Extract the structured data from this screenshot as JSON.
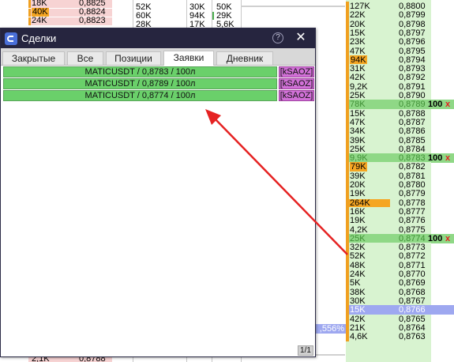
{
  "window": {
    "title": "Сделки",
    "help_icon": "help-icon",
    "close_icon": "close-icon",
    "help_glyph": "?",
    "close_glyph": "✕",
    "tabs": [
      {
        "label": "Закрытые",
        "active": false
      },
      {
        "label": "Все",
        "active": false
      },
      {
        "label": "Позиции",
        "active": false
      },
      {
        "label": "Заявки",
        "active": true
      },
      {
        "label": "Дневник",
        "active": false
      }
    ],
    "orders": [
      {
        "text": "MATICUSDT / 0,8783 / 100л",
        "tag": "[kSAOZ]"
      },
      {
        "text": "MATICUSDT / 0,8789 / 100л",
        "tag": "[kSAOZ]"
      },
      {
        "text": "MATICUSDT / 0,8774 / 100л",
        "tag": "[kSAOZ]"
      }
    ],
    "pager": "1/1"
  },
  "left_book": {
    "rows_top": [
      {
        "vol": "18K",
        "price": "0,8825"
      },
      {
        "vol": "40K",
        "price": "0,8824"
      },
      {
        "vol": "24K",
        "price": "0,8823"
      }
    ],
    "row_bottom": {
      "vol": "2,1K",
      "price": "0,8788"
    }
  },
  "middle_columns": {
    "col1": [
      "52K",
      "60K",
      "28K"
    ],
    "col2": [
      "30K",
      "94K",
      "17K"
    ],
    "col3": [
      "50K",
      "29K",
      "5,6K"
    ]
  },
  "right_book": {
    "percent_label": ",556%",
    "rows": [
      {
        "vol": "127K",
        "price": "0,8800",
        "type": "ask"
      },
      {
        "vol": "22K",
        "price": "0,8799",
        "type": "ask"
      },
      {
        "vol": "20K",
        "price": "0,8798",
        "type": "ask"
      },
      {
        "vol": "15K",
        "price": "0,8797",
        "type": "ask"
      },
      {
        "vol": "23K",
        "price": "0,8796",
        "type": "ask"
      },
      {
        "vol": "47K",
        "price": "0,8795",
        "type": "ask"
      },
      {
        "vol": "94K",
        "price": "0,8794",
        "type": "ask",
        "hl": true
      },
      {
        "vol": "31K",
        "price": "0,8793",
        "type": "ask"
      },
      {
        "vol": "42K",
        "price": "0,8792",
        "type": "ask"
      },
      {
        "vol": "9,2K",
        "price": "0,8791",
        "type": "ask"
      },
      {
        "vol": "25K",
        "price": "0,8790",
        "type": "ask"
      },
      {
        "vol": "78K",
        "price": "0,8789",
        "type": "lvl",
        "order_qty": "100",
        "order_x": "x"
      },
      {
        "vol": "15K",
        "price": "0,8788",
        "type": "ask"
      },
      {
        "vol": "47K",
        "price": "0,8787",
        "type": "ask"
      },
      {
        "vol": "34K",
        "price": "0,8786",
        "type": "ask"
      },
      {
        "vol": "39K",
        "price": "0,8785",
        "type": "ask"
      },
      {
        "vol": "25K",
        "price": "0,8784",
        "type": "ask"
      },
      {
        "vol": "9,9K",
        "price": "0,8783",
        "type": "lvl",
        "order_qty": "100",
        "order_x": "x"
      },
      {
        "vol": "79K",
        "price": "0,8782",
        "type": "ask",
        "hl": true
      },
      {
        "vol": "39K",
        "price": "0,8781",
        "type": "ask"
      },
      {
        "vol": "20K",
        "price": "0,8780",
        "type": "ask"
      },
      {
        "vol": "19K",
        "price": "0,8779",
        "type": "ask"
      },
      {
        "vol": "264K",
        "price": "0,8778",
        "type": "ask",
        "bar": 0.5
      },
      {
        "vol": "16K",
        "price": "0,8777",
        "type": "ask"
      },
      {
        "vol": "19K",
        "price": "0,8776",
        "type": "ask"
      },
      {
        "vol": "4,2K",
        "price": "0,8775",
        "type": "ask"
      },
      {
        "vol": "25K",
        "price": "0,8774",
        "type": "lvl",
        "order_qty": "100",
        "order_x": "x"
      },
      {
        "vol": "32K",
        "price": "0,8773",
        "type": "ask"
      },
      {
        "vol": "52K",
        "price": "0,8772",
        "type": "ask"
      },
      {
        "vol": "48K",
        "price": "0,8771",
        "type": "ask"
      },
      {
        "vol": "24K",
        "price": "0,8770",
        "type": "ask"
      },
      {
        "vol": "5K",
        "price": "0,8769",
        "type": "ask"
      },
      {
        "vol": "38K",
        "price": "0,8768",
        "type": "ask"
      },
      {
        "vol": "30K",
        "price": "0,8767",
        "type": "ask"
      },
      {
        "vol": "15K",
        "price": "0,8766",
        "type": "cur"
      },
      {
        "vol": "42K",
        "price": "0,8765",
        "type": "ask"
      },
      {
        "vol": "21K",
        "price": "0,8764",
        "type": "ask"
      },
      {
        "vol": "4,6K",
        "price": "0,8763",
        "type": "ask"
      }
    ]
  },
  "colors": {
    "title_bar": "#26253f",
    "order_row": "#6ad06a",
    "order_tag": "#d070d6",
    "arrow": "#e52222",
    "ask_bg": "#d8f3d0",
    "volume_bar": "#f5a623"
  }
}
